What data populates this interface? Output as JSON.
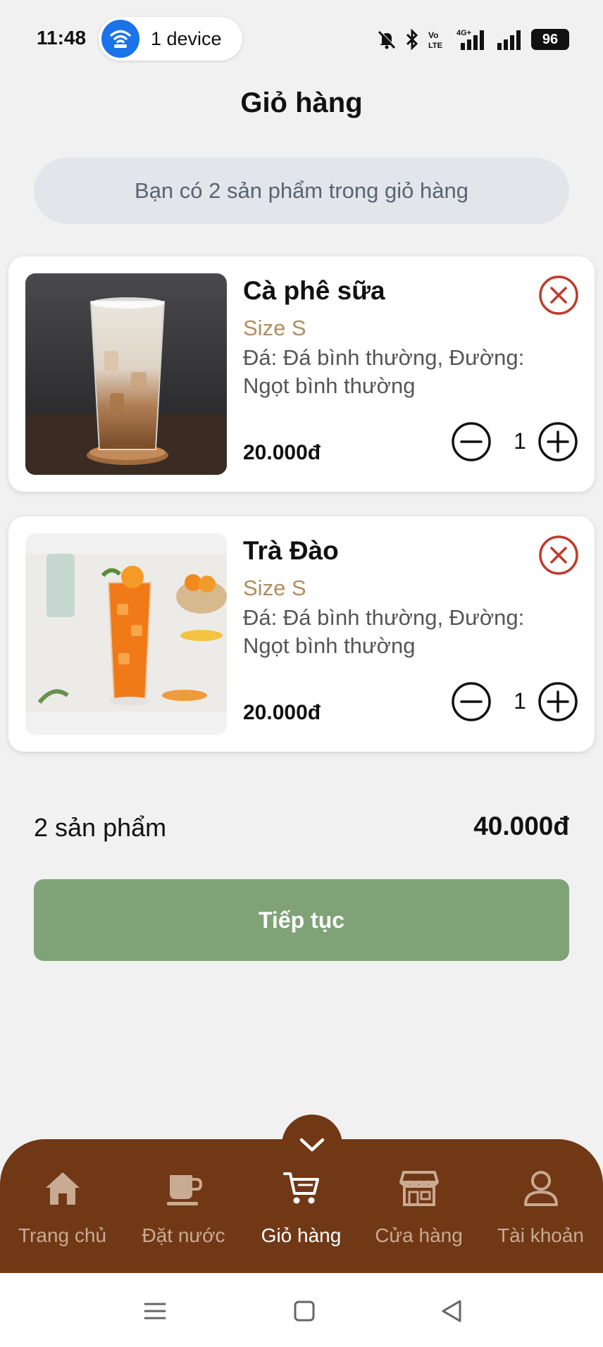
{
  "status_bar": {
    "time": "11:48",
    "device_label": "1 device",
    "battery": "96",
    "icons": [
      "wifi-hotspot-icon",
      "bell-off-icon",
      "bluetooth-icon",
      "volte-icon",
      "signal-4g-icon",
      "signal-icon",
      "battery-icon"
    ]
  },
  "header": {
    "title": "Giỏ hàng"
  },
  "cart_info": "Bạn có 2 sản phẩm trong giỏ hàng",
  "items": [
    {
      "name": "Cà phê sữa",
      "size": "Size S",
      "options": "Đá: Đá bình thường, Đường: Ngọt bình thường",
      "price": "20.000đ",
      "quantity": "1"
    },
    {
      "name": "Trà Đào",
      "size": "Size S",
      "options": "Đá: Đá bình thường, Đường: Ngọt bình thường",
      "price": "20.000đ",
      "quantity": "1"
    }
  ],
  "summary": {
    "count_label": "2 sản phẩm",
    "total": "40.000đ",
    "continue_label": "Tiếp tục"
  },
  "bottom_nav": {
    "items": [
      {
        "label": "Trang chủ",
        "icon": "home-icon",
        "active": false
      },
      {
        "label": "Đặt nước",
        "icon": "coffee-cup-icon",
        "active": false
      },
      {
        "label": "Giỏ hàng",
        "icon": "cart-icon",
        "active": true
      },
      {
        "label": "Cửa hàng",
        "icon": "store-icon",
        "active": false
      },
      {
        "label": "Tài khoản",
        "icon": "user-icon",
        "active": false
      }
    ]
  },
  "colors": {
    "nav_brown": "#713816",
    "continue_green": "#7fa277",
    "size_tan": "#b08c5e",
    "remove_red": "#c0392b",
    "nav_inactive": "#c9aa92"
  }
}
